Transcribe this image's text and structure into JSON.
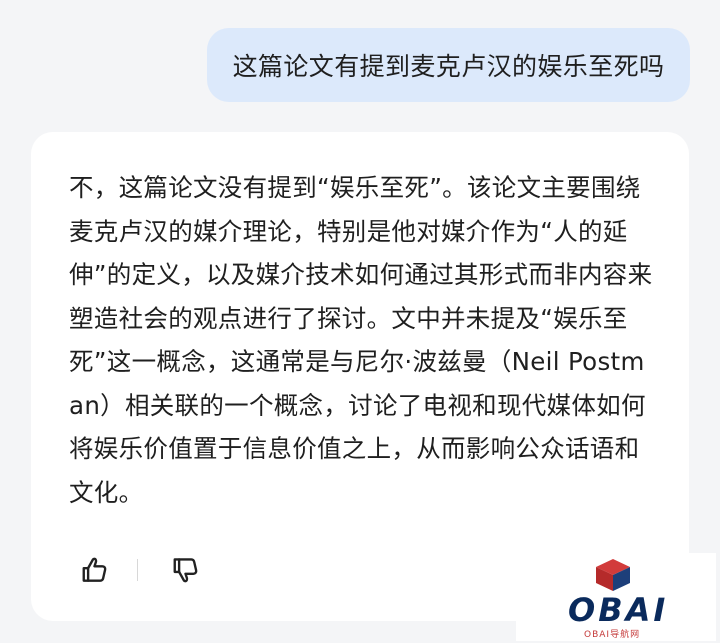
{
  "user_message": {
    "text": "这篇论文有提到麦克卢汉的娱乐至死吗"
  },
  "assistant_message": {
    "text": "不，这篇论文没有提到“娱乐至死”。该论文主要围绕麦克卢汉的媒介理论，特别是他对媒介作为“人的延伸”的定义，以及媒介技术如何通过其形式而非内容来塑造社会的观点进行了探讨。文中并未提及“娱乐至死”这一概念，这通常是与尼尔·波兹曼（Neil Postman）相关联的一个概念，讨论了电视和现代媒体如何将娱乐价值置于信息价值之上，从而影响公众话语和文化。"
  },
  "feedback": {
    "like_icon": "thumbs-up-icon",
    "dislike_icon": "thumbs-down-icon"
  },
  "watermark": {
    "logo_text": "OBAI",
    "subtitle": "OBAI导航网",
    "colors": {
      "logo": "#0a2a5c",
      "cube_top": "#d23b3b",
      "cube_side": "#1d3f7a",
      "subtitle": "#c53a3a"
    }
  },
  "colors": {
    "background": "#f4f5f7",
    "user_bubble": "#dce9fb",
    "card": "#ffffff",
    "text": "#1f1f1f"
  }
}
